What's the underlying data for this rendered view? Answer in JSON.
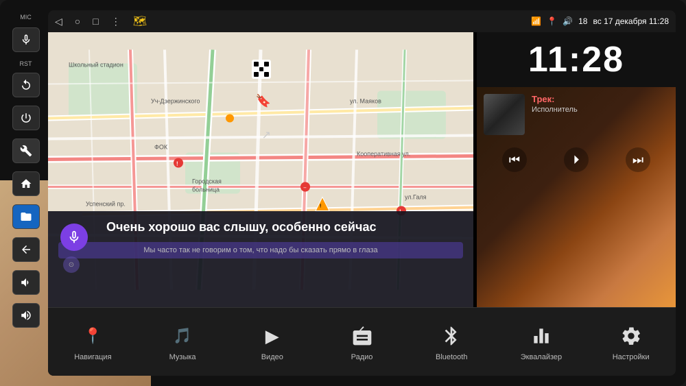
{
  "device": {
    "background": "#111111"
  },
  "status_bar": {
    "wifi": "📶",
    "location": "🔊",
    "volume": "18",
    "datetime": "вс 17 декабря 11:28"
  },
  "android_nav": {
    "back": "◁",
    "home": "○",
    "recent": "□",
    "more": "⋮"
  },
  "left_buttons": [
    {
      "id": "mic",
      "label": "MIC",
      "icon": "🎤"
    },
    {
      "id": "rst",
      "label": "RST",
      "icon": "↺"
    },
    {
      "id": "power",
      "label": "",
      "icon": "⏻"
    },
    {
      "id": "settings",
      "label": "",
      "icon": "🔧"
    },
    {
      "id": "home",
      "label": "",
      "icon": "⌂"
    },
    {
      "id": "folder",
      "label": "",
      "icon": "📁"
    },
    {
      "id": "back",
      "label": "",
      "icon": "↩"
    },
    {
      "id": "vol_up",
      "label": "",
      "icon": "+"
    },
    {
      "id": "vol_down",
      "label": "",
      "icon": "−"
    }
  ],
  "clock": {
    "time": "11:28"
  },
  "media": {
    "track_label": "Трек:",
    "track_name": "",
    "artist_label": "Исполнитель"
  },
  "map": {
    "street1": "Уч-Дзержинского",
    "street2": "Школьный стадион",
    "street3": "ул. Маяков",
    "street4": "Кооперативная ул.",
    "street5": "Городская больница",
    "street6": "Успенский пр.",
    "street7": "ул. Галя",
    "street8": "ФОК"
  },
  "voice_assistant": {
    "main_text": "Очень хорошо вас слышу, особенно сейчас",
    "sub_text": "Мы часто так не говорим о том, что надо бы сказать прямо в глаза"
  },
  "bottom_menu": {
    "items": [
      {
        "id": "navigation",
        "icon": "📍",
        "label": "Навигация"
      },
      {
        "id": "music",
        "icon": "🎵",
        "label": "Музыка"
      },
      {
        "id": "video",
        "icon": "▶",
        "label": "Видео"
      },
      {
        "id": "radio",
        "icon": "📻",
        "label": "Радио"
      },
      {
        "id": "bluetooth",
        "icon": "🔷",
        "label": "Bluetooth"
      },
      {
        "id": "equalizer",
        "icon": "🎚",
        "label": "Эквалайзер"
      },
      {
        "id": "settings",
        "icon": "⚙",
        "label": "Настройки"
      }
    ]
  }
}
